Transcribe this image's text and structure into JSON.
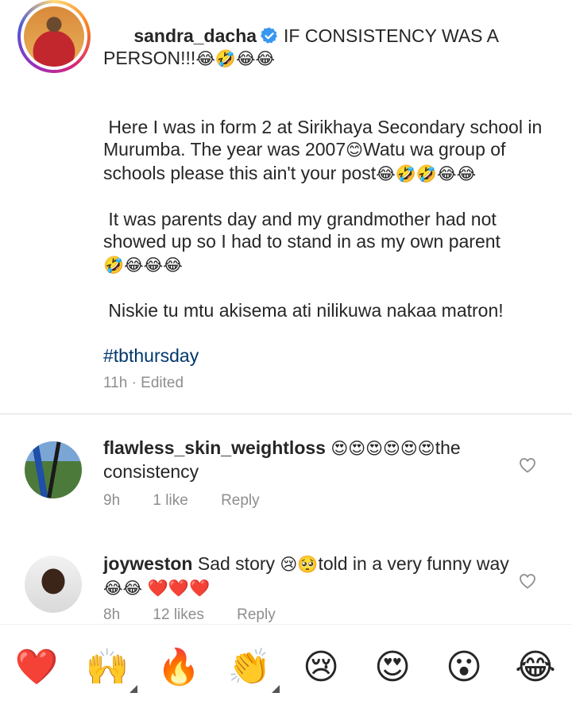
{
  "post": {
    "username": "sandra_dacha",
    "headline": "IF CONSISTENCY WAS A PERSON!!!",
    "headline_emoji": "😂🤣😂😂",
    "para1": "Here I was in form 2 at Sirikhaya Secondary school in Murumba. The year was 2007",
    "para1_emoji": "😊",
    "para1b": "Watu wa group of schools please this ain't your post",
    "para1b_emoji": "😂🤣🤣😂😂",
    "para2": "It was parents day and my grandmother had not showed up so I had to stand in as my own parent",
    "para2_emoji": "🤣😂😂😂",
    "para3": "Niskie tu mtu akisema ati nilikuwa nakaa matron!",
    "hashtag": "#tbthursday",
    "time": "11h",
    "edited": "· Edited"
  },
  "comments": [
    {
      "username": "flawless_skin_weightloss",
      "emoji": "😍😍😍😍😍😍",
      "text": "the consistency",
      "time": "9h",
      "likes": "1 like",
      "reply": "Reply"
    },
    {
      "username": "joyweston",
      "text_a": "Sad story",
      "emoji_a": "😢🥺",
      "text_b": "told in a very funny way",
      "emoji_b": "😂😂 ❤️❤️❤️",
      "time": "8h",
      "likes": "12 likes",
      "reply": "Reply"
    }
  ],
  "reactions": [
    "❤️",
    "🙌",
    "🔥",
    "👏",
    "😢",
    "😍",
    "😮",
    "😂"
  ],
  "icons": {
    "verified": "verified-badge-icon",
    "like": "heart-outline-icon"
  },
  "colors": {
    "verified": "#3897f0",
    "hashtag": "#00376b",
    "meta": "#8e8e8e"
  }
}
